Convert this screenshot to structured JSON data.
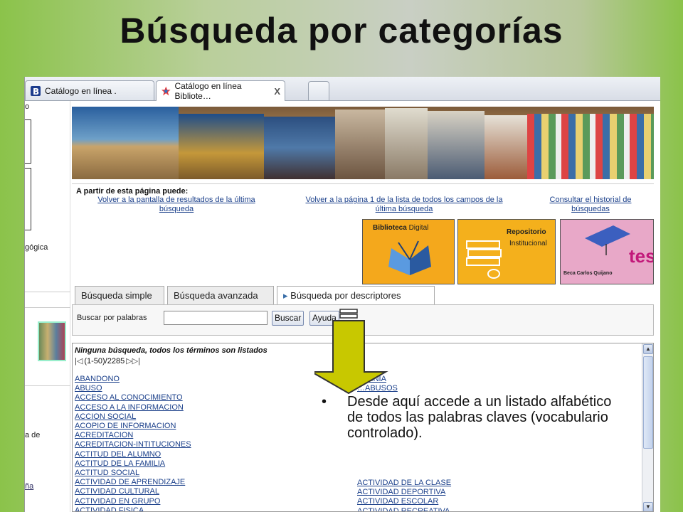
{
  "slide": {
    "title": "Búsqueda por categorías"
  },
  "browser": {
    "tabs": [
      {
        "label": "Catálogo en línea ."
      },
      {
        "label": "Catálogo en línea Bibliote…",
        "close": "X"
      }
    ]
  },
  "left_panel": {
    "fragments": [
      "o",
      "gógica",
      "a de",
      "ña"
    ]
  },
  "options": {
    "heading": "A partir de esta página puede:",
    "links": [
      {
        "line1": "Volver a la pantalla de resultados de la última",
        "line2": "búsqueda"
      },
      {
        "line1": "Volver a la página 1 de la lista de todos los campos de la",
        "line2": "última búsqueda"
      },
      {
        "line1": "Consultar el historial de",
        "line2": "búsquedas"
      }
    ]
  },
  "logos": {
    "biblioteca": {
      "word1": "Biblioteca",
      "word2": "Digital"
    },
    "repositorio": {
      "word1": "Repositorio",
      "word2": "Institucional"
    },
    "tesis": {
      "caption": "Beca Carlos Quijano",
      "word": "tesis"
    }
  },
  "search": {
    "tabs": [
      "Búsqueda simple",
      "Búsqueda avanzada",
      "Búsqueda por descriptores"
    ],
    "active_tab_marker": "▸",
    "label": "Buscar por palabras",
    "input_value": "",
    "buttons": {
      "search": "Buscar",
      "help": "Ayuda"
    }
  },
  "results": {
    "title": "Ninguna búsqueda, todos los términos son listados",
    "count": "(1-50)/2285",
    "column1": [
      "ABANDONO",
      "ABUSO",
      "ACCESO AL CONOCIMIENTO",
      "ACCESO A LA INFORMACION",
      "ACCION SOCIAL",
      "ACOPIO DE INFORMACION",
      "ACREDITACION",
      "ACREDITACION-INTITUCIONES",
      "ACTITUD DEL ALUMNO",
      "ACTITUD DE LA FAMILIA",
      "ACTITUD SOCIAL",
      "ACTIVIDAD DE APRENDIZAJE",
      "ACTIVIDAD CULTURAL",
      "ACTIVIDAD EN GRUPO",
      "ACTIVIDAD FISICA"
    ],
    "column2_partial": [
      "…GINIA",
      "…ABUSOS"
    ],
    "column2": [
      "ACTIVIDAD DE LA CLASE",
      "ACTIVIDAD DEPORTIVA",
      "ACTIVIDAD ESCOLAR",
      "ACTIVIDAD RECREATIVA"
    ]
  },
  "callout": {
    "bullet": "•",
    "text": "Desde aquí accede a un listado alfabético de todos las palabras claves (vocabulario controlado)."
  },
  "colors": {
    "arrow_fill": "#c8c800",
    "link": "#1a3f8a",
    "biblioteca_bg": "#f4a81c",
    "tesis_bg": "#e8a8c8"
  }
}
